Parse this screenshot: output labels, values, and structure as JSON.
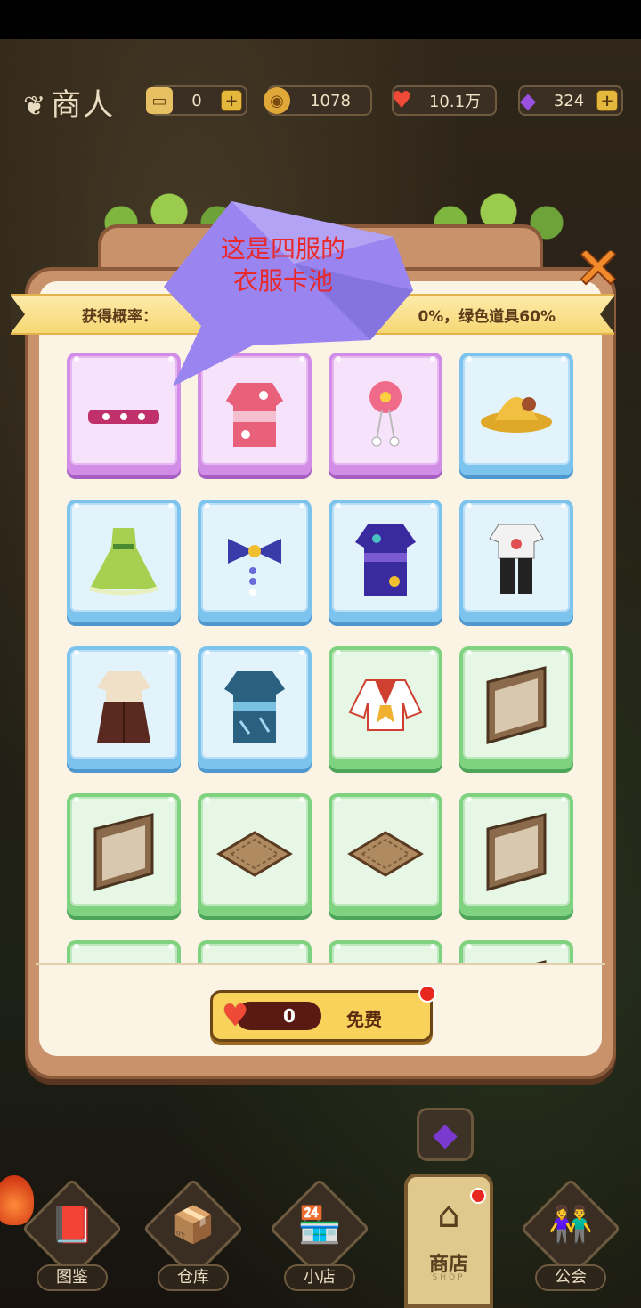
{
  "header": {
    "title": "商人",
    "resources": [
      {
        "name": "ticket",
        "value": "0",
        "icon": "ticket-icon",
        "has_plus": true
      },
      {
        "name": "coin",
        "value": "1078",
        "icon": "coin-icon",
        "has_plus": false
      },
      {
        "name": "heart",
        "value": "10.1万",
        "icon": "heart-icon",
        "has_plus": false
      },
      {
        "name": "gem",
        "value": "324",
        "icon": "gem-icon",
        "has_plus": true
      }
    ]
  },
  "dialog": {
    "ribbon_left": "获得概率：",
    "ribbon_right": "0%，绿色道具60%",
    "cost": "0",
    "free_label": "免费",
    "items": [
      {
        "rarity": "purple",
        "icon": "headband-icon"
      },
      {
        "rarity": "purple",
        "icon": "pink-kimono-icon"
      },
      {
        "rarity": "purple",
        "icon": "flower-hairpin-icon"
      },
      {
        "rarity": "blue",
        "icon": "bucket-hat-icon"
      },
      {
        "rarity": "blue",
        "icon": "green-dress-icon"
      },
      {
        "rarity": "blue",
        "icon": "bow-hairpin-icon"
      },
      {
        "rarity": "blue",
        "icon": "purple-kimono-icon"
      },
      {
        "rarity": "blue",
        "icon": "shirt-pants-outfit-icon"
      },
      {
        "rarity": "blue",
        "icon": "hakama-outfit-icon"
      },
      {
        "rarity": "blue",
        "icon": "teal-kimono-icon"
      },
      {
        "rarity": "green",
        "icon": "sailor-shirt-icon"
      },
      {
        "rarity": "green",
        "icon": "wooden-panel-icon"
      },
      {
        "rarity": "green",
        "icon": "wooden-panel-icon"
      },
      {
        "rarity": "green",
        "icon": "tatami-mat-icon"
      },
      {
        "rarity": "green",
        "icon": "tatami-mat-icon"
      },
      {
        "rarity": "green",
        "icon": "wooden-panel-icon"
      },
      {
        "rarity": "green",
        "icon": "unknown-item-icon"
      },
      {
        "rarity": "green",
        "icon": "unknown-item-icon"
      },
      {
        "rarity": "green",
        "icon": "unknown-item-icon"
      },
      {
        "rarity": "green",
        "icon": "wooden-panel-icon"
      }
    ]
  },
  "annotation": {
    "text": "这是四服的衣服卡池",
    "color": "#e8282a",
    "balloon_color": "#9a85f0"
  },
  "nav": {
    "items": [
      {
        "label": "图鉴",
        "icon": "book-icon"
      },
      {
        "label": "仓库",
        "icon": "warehouse-icon"
      },
      {
        "label": "小店",
        "icon": "store-icon"
      },
      {
        "label": "商店",
        "sub": "SHOP",
        "icon": "shop-icon",
        "active": true
      },
      {
        "label": "公会",
        "icon": "guild-icon"
      }
    ]
  },
  "colors": {
    "panel": "#c9926a",
    "panel_inner": "#fbf3e4",
    "purple_card": "#d28ee6",
    "blue_card": "#7cc3ee",
    "green_card": "#7fd27f",
    "button": "#f8d25a"
  }
}
